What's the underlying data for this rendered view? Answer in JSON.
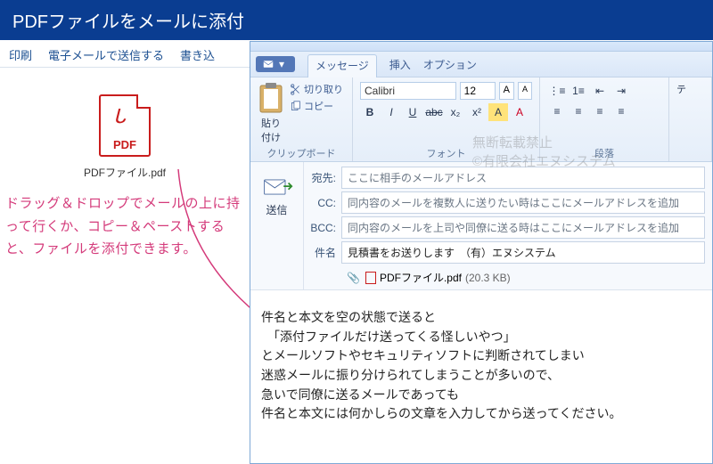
{
  "banner": {
    "title": "PDFファイルをメールに添付"
  },
  "desktop": {
    "toolbar": {
      "print": "印刷",
      "send_email": "電子メールで送信する",
      "write": "書き込"
    },
    "file": {
      "label": "PDF",
      "name": "PDFファイル.pdf"
    },
    "explain": "ドラッグ＆ドロップでメールの上に持って行くか、コピー＆ペーストすると、ファイルを添付できます。"
  },
  "mail": {
    "menubar": {
      "menu": "▾",
      "message": "メッセージ",
      "insert": "挿入",
      "option": "オプション"
    },
    "ribbon": {
      "clipboard": {
        "paste": "貼り\n付け",
        "cut": "切り取り",
        "copy": "コピー",
        "label": "クリップボード"
      },
      "font": {
        "name": "Calibri",
        "size": "12",
        "label": "フォント"
      },
      "paragraph": {
        "label": "段落"
      },
      "edit": {
        "label": "テ"
      }
    },
    "compose": {
      "send": "送信",
      "to_label": "宛先:",
      "to_ph": "ここに相手のメールアドレス",
      "cc_label": "CC:",
      "cc_ph": "同内容のメールを複数人に送りたい時はここにメールアドレスを追加",
      "bcc_label": "BCC:",
      "bcc_ph": "同内容のメールを上司や同僚に送る時はここにメールアドレスを追加",
      "subj_label": "件名",
      "subj_val": "見積書をお送りします　（有）エヌシステム",
      "attach": {
        "name": "PDFファイル.pdf",
        "size": "(20.3 KB)"
      }
    },
    "body": "件名と本文を空の状態で送ると\n　「添付ファイルだけ送ってくる怪しいやつ」\nとメールソフトやセキュリティソフトに判断されてしまい\n迷惑メールに振り分けられてしまうことが多いので、\n急いで同僚に送るメールであっても\n件名と本文には何かしらの文章を入力してから送ってください。",
    "watermark": {
      "l1": "無断転載禁止",
      "l2": "©有限会社エヌシステム"
    }
  }
}
